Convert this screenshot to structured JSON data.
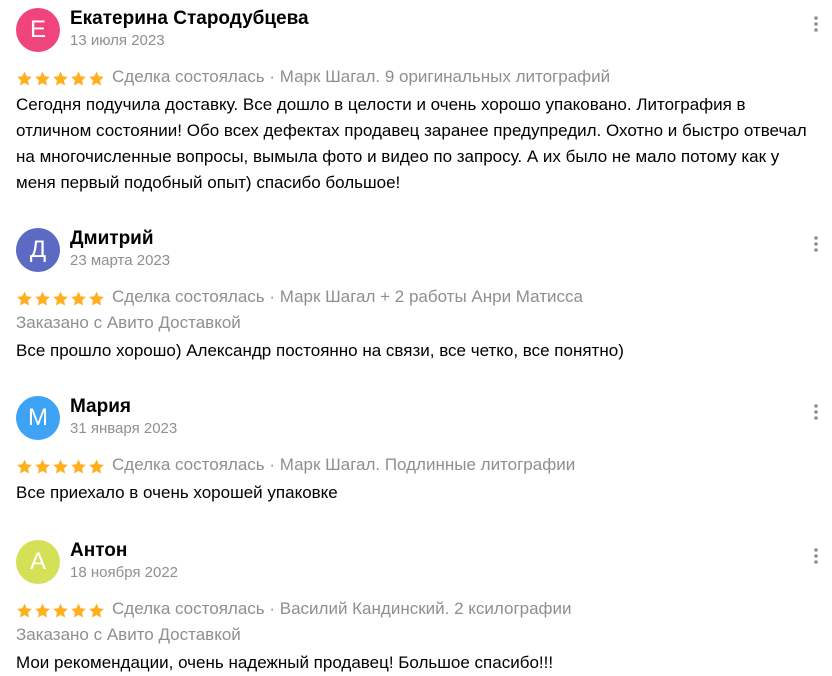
{
  "colors": {
    "star": "#ffb021",
    "muted": "#8f8f8f"
  },
  "reviews": [
    {
      "name": "Екатерина Стародубцева",
      "initial": "Е",
      "avatar_color": "#f0457c",
      "date": "13 июля 2023",
      "rating": 5,
      "meta": "Сделка состоялась · Марк Шагал. 9 оригинальных литографий",
      "delivery": "",
      "text": "Сегодня подучила доставку. Все дошло в целости и очень хорошо упаковано. Литография в отличном состоянии! Обо всех дефектах продавец заранее предупредил. Охотно и быстро отвечал на многочисленные вопросы, вымыла фото и видео по запросу. А их было не мало потому как у меня первый подобный опыт) спасибо большое!"
    },
    {
      "name": "Дмитрий",
      "initial": "Д",
      "avatar_color": "#5c6ac4",
      "date": "23 марта 2023",
      "rating": 5,
      "meta": "Сделка состоялась · Марк Шагал + 2 работы Анри Матисса",
      "delivery": "Заказано с Авито Доставкой",
      "text": "Все прошло хорошо) Александр постоянно на связи, все четко, все понятно)"
    },
    {
      "name": "Мария",
      "initial": "М",
      "avatar_color": "#3ea3f5",
      "date": "31 января 2023",
      "rating": 5,
      "meta": "Сделка состоялась · Марк Шагал. Подлинные литографии",
      "delivery": "",
      "text": "Все приехало в очень хорошей упаковке"
    },
    {
      "name": "Антон",
      "initial": "А",
      "avatar_color": "#d4e157",
      "date": "18 ноября 2022",
      "rating": 5,
      "meta": "Сделка состоялась · Василий Кандинский. 2 ксилографии",
      "delivery": "Заказано с Авито Доставкой",
      "text": "Мои рекомендации, очень надежный продавец! Большое спасибо!!!"
    }
  ]
}
